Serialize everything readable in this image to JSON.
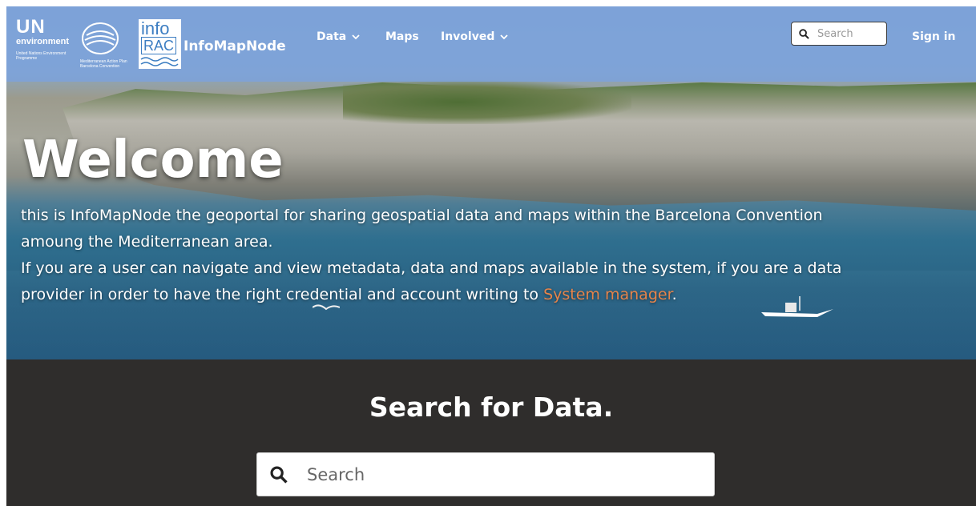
{
  "navbar": {
    "logos": {
      "un_text": "UN",
      "un_sub": "environment",
      "un_small": "United Nations Environment Programme",
      "map_small": "Mediterranean Action Plan Barcelona Convention",
      "info_line1": "info",
      "info_line2": "RAC"
    },
    "brand": "InfoMapNode",
    "items": [
      {
        "label": "Data",
        "has_dropdown": true
      },
      {
        "label": "Maps",
        "has_dropdown": false
      },
      {
        "label": "Involved",
        "has_dropdown": true
      }
    ],
    "search": {
      "placeholder": "Search",
      "icon": "search-icon"
    },
    "signin": "Sign in",
    "colors": {
      "bar": "#7ca2db",
      "text": "#ffffff"
    }
  },
  "hero": {
    "title": "Welcome",
    "paragraph_line1": "this is InfoMapNode the geoportal for sharing geospatial data and maps within the Barcelona Convention",
    "paragraph_line2": "amoung the Mediterranean area.",
    "paragraph_line3": "If you are a user can navigate and view metadata, data and maps available in the system, if you are a data",
    "paragraph_line4_before": "provider in order to have the right credential and account writing to ",
    "link_text": "System manager",
    "paragraph_line4_after": ".",
    "link_color": "#e7844a"
  },
  "search_section": {
    "heading": "Search for Data.",
    "placeholder": "Search",
    "icon": "search-icon",
    "background": "#2f2d2c"
  }
}
